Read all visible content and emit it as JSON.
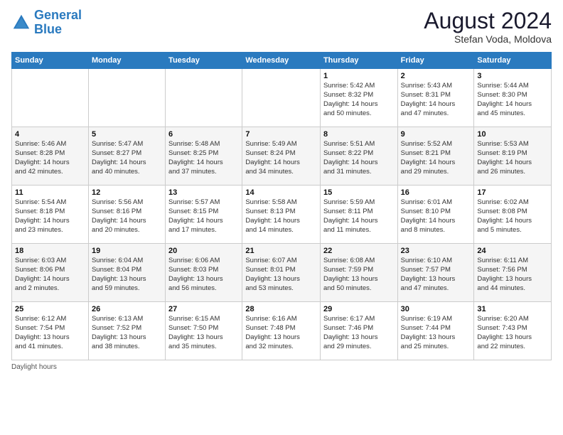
{
  "header": {
    "logo_line1": "General",
    "logo_line2": "Blue",
    "month_year": "August 2024",
    "location": "Stefan Voda, Moldova"
  },
  "days_of_week": [
    "Sunday",
    "Monday",
    "Tuesday",
    "Wednesday",
    "Thursday",
    "Friday",
    "Saturday"
  ],
  "weeks": [
    [
      {
        "day": "",
        "info": ""
      },
      {
        "day": "",
        "info": ""
      },
      {
        "day": "",
        "info": ""
      },
      {
        "day": "",
        "info": ""
      },
      {
        "day": "1",
        "info": "Sunrise: 5:42 AM\nSunset: 8:32 PM\nDaylight: 14 hours\nand 50 minutes."
      },
      {
        "day": "2",
        "info": "Sunrise: 5:43 AM\nSunset: 8:31 PM\nDaylight: 14 hours\nand 47 minutes."
      },
      {
        "day": "3",
        "info": "Sunrise: 5:44 AM\nSunset: 8:30 PM\nDaylight: 14 hours\nand 45 minutes."
      }
    ],
    [
      {
        "day": "4",
        "info": "Sunrise: 5:46 AM\nSunset: 8:28 PM\nDaylight: 14 hours\nand 42 minutes."
      },
      {
        "day": "5",
        "info": "Sunrise: 5:47 AM\nSunset: 8:27 PM\nDaylight: 14 hours\nand 40 minutes."
      },
      {
        "day": "6",
        "info": "Sunrise: 5:48 AM\nSunset: 8:25 PM\nDaylight: 14 hours\nand 37 minutes."
      },
      {
        "day": "7",
        "info": "Sunrise: 5:49 AM\nSunset: 8:24 PM\nDaylight: 14 hours\nand 34 minutes."
      },
      {
        "day": "8",
        "info": "Sunrise: 5:51 AM\nSunset: 8:22 PM\nDaylight: 14 hours\nand 31 minutes."
      },
      {
        "day": "9",
        "info": "Sunrise: 5:52 AM\nSunset: 8:21 PM\nDaylight: 14 hours\nand 29 minutes."
      },
      {
        "day": "10",
        "info": "Sunrise: 5:53 AM\nSunset: 8:19 PM\nDaylight: 14 hours\nand 26 minutes."
      }
    ],
    [
      {
        "day": "11",
        "info": "Sunrise: 5:54 AM\nSunset: 8:18 PM\nDaylight: 14 hours\nand 23 minutes."
      },
      {
        "day": "12",
        "info": "Sunrise: 5:56 AM\nSunset: 8:16 PM\nDaylight: 14 hours\nand 20 minutes."
      },
      {
        "day": "13",
        "info": "Sunrise: 5:57 AM\nSunset: 8:15 PM\nDaylight: 14 hours\nand 17 minutes."
      },
      {
        "day": "14",
        "info": "Sunrise: 5:58 AM\nSunset: 8:13 PM\nDaylight: 14 hours\nand 14 minutes."
      },
      {
        "day": "15",
        "info": "Sunrise: 5:59 AM\nSunset: 8:11 PM\nDaylight: 14 hours\nand 11 minutes."
      },
      {
        "day": "16",
        "info": "Sunrise: 6:01 AM\nSunset: 8:10 PM\nDaylight: 14 hours\nand 8 minutes."
      },
      {
        "day": "17",
        "info": "Sunrise: 6:02 AM\nSunset: 8:08 PM\nDaylight: 14 hours\nand 5 minutes."
      }
    ],
    [
      {
        "day": "18",
        "info": "Sunrise: 6:03 AM\nSunset: 8:06 PM\nDaylight: 14 hours\nand 2 minutes."
      },
      {
        "day": "19",
        "info": "Sunrise: 6:04 AM\nSunset: 8:04 PM\nDaylight: 13 hours\nand 59 minutes."
      },
      {
        "day": "20",
        "info": "Sunrise: 6:06 AM\nSunset: 8:03 PM\nDaylight: 13 hours\nand 56 minutes."
      },
      {
        "day": "21",
        "info": "Sunrise: 6:07 AM\nSunset: 8:01 PM\nDaylight: 13 hours\nand 53 minutes."
      },
      {
        "day": "22",
        "info": "Sunrise: 6:08 AM\nSunset: 7:59 PM\nDaylight: 13 hours\nand 50 minutes."
      },
      {
        "day": "23",
        "info": "Sunrise: 6:10 AM\nSunset: 7:57 PM\nDaylight: 13 hours\nand 47 minutes."
      },
      {
        "day": "24",
        "info": "Sunrise: 6:11 AM\nSunset: 7:56 PM\nDaylight: 13 hours\nand 44 minutes."
      }
    ],
    [
      {
        "day": "25",
        "info": "Sunrise: 6:12 AM\nSunset: 7:54 PM\nDaylight: 13 hours\nand 41 minutes."
      },
      {
        "day": "26",
        "info": "Sunrise: 6:13 AM\nSunset: 7:52 PM\nDaylight: 13 hours\nand 38 minutes."
      },
      {
        "day": "27",
        "info": "Sunrise: 6:15 AM\nSunset: 7:50 PM\nDaylight: 13 hours\nand 35 minutes."
      },
      {
        "day": "28",
        "info": "Sunrise: 6:16 AM\nSunset: 7:48 PM\nDaylight: 13 hours\nand 32 minutes."
      },
      {
        "day": "29",
        "info": "Sunrise: 6:17 AM\nSunset: 7:46 PM\nDaylight: 13 hours\nand 29 minutes."
      },
      {
        "day": "30",
        "info": "Sunrise: 6:19 AM\nSunset: 7:44 PM\nDaylight: 13 hours\nand 25 minutes."
      },
      {
        "day": "31",
        "info": "Sunrise: 6:20 AM\nSunset: 7:43 PM\nDaylight: 13 hours\nand 22 minutes."
      }
    ]
  ],
  "footer": {
    "note": "Daylight hours"
  }
}
